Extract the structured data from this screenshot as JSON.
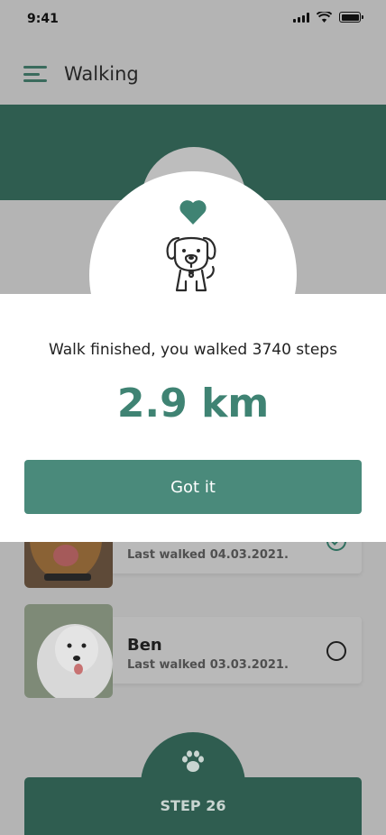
{
  "status_bar": {
    "time": "9:41"
  },
  "header": {
    "title": "Walking"
  },
  "modal": {
    "message": "Walk finished, you walked 3740 steps",
    "distance": "2.9 km",
    "button_label": "Got it"
  },
  "dogs": [
    {
      "name": "",
      "last_walked": "Last walked 04.03.2021.",
      "selected": true
    },
    {
      "name": "Ben",
      "last_walked": "Last walked 03.03.2021.",
      "selected": false
    }
  ],
  "step_button": {
    "label": "STEP 26"
  },
  "colors": {
    "primary_dark": "#2f5d50",
    "primary": "#4a8a7b",
    "accent_text": "#3f8373",
    "overlay_bg": "#b4b4b4"
  },
  "icons": [
    "menu-icon",
    "heart-icon",
    "dog-icon",
    "paw-icon",
    "check-icon",
    "radio-icon",
    "signal-icon",
    "wifi-icon",
    "battery-icon"
  ]
}
